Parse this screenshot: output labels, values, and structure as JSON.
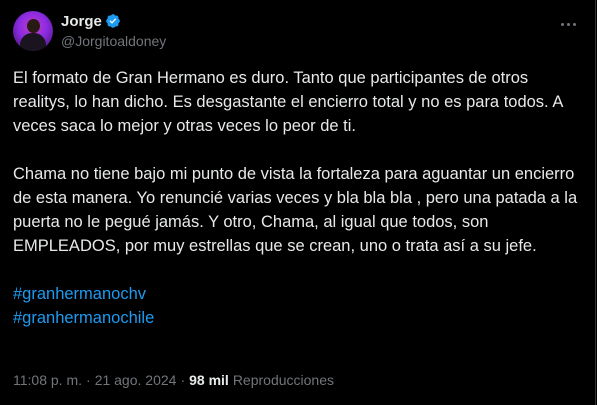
{
  "author": {
    "display_name": "Jorge",
    "handle": "@Jorgitoaldoney",
    "verified": true
  },
  "tweet": {
    "paragraphs": [
      "El formato de Gran Hermano es duro. Tanto que participantes de otros realitys, lo han dicho. Es desgastante el encierro total y no es para todos. A veces saca lo mejor y otras veces lo peor de ti.",
      "Chama no tiene bajo mi punto de vista la fortaleza para aguantar un encierro de esta manera. Yo renuncié varias veces y bla bla bla , pero una patada a la puerta no le pegué jamás. Y otro, Chama, al igual que todos, son EMPLEADOS, por muy estrellas que se crean, uno o trata así a su jefe."
    ],
    "hashtags": [
      "#granhermanochv",
      "#granhermanochile"
    ]
  },
  "meta": {
    "time": "11:08 p. m.",
    "separator": "·",
    "date": "21 ago. 2024",
    "views_count": "98 mil",
    "views_label": "Reproducciones"
  },
  "colors": {
    "background": "#000000",
    "text": "#e7e9ea",
    "muted": "#71767b",
    "link": "#1d9bf0",
    "verified": "#1d9bf0"
  },
  "icons": {
    "verified": "verified-badge-icon",
    "more": "more-horizontal-icon"
  }
}
